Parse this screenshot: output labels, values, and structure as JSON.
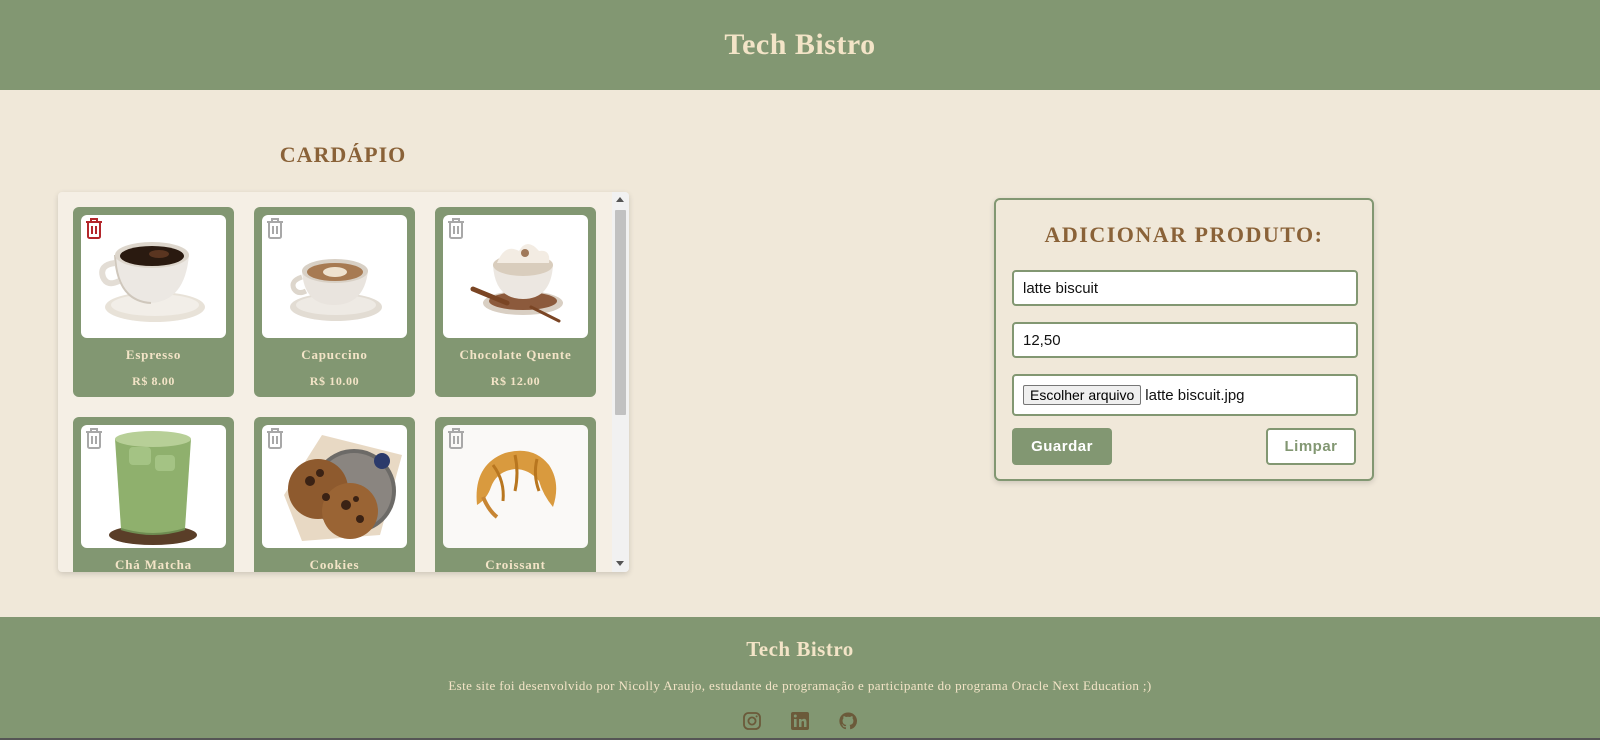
{
  "header": {
    "title": "Tech Bistro"
  },
  "menu": {
    "title": "CARDÁPIO",
    "items": [
      {
        "name": "Espresso",
        "price": "R$ 8.00",
        "image": "espresso-cup"
      },
      {
        "name": "Capuccino",
        "price": "R$ 10.00",
        "image": "cappuccino-cup"
      },
      {
        "name": "Chocolate Quente",
        "price": "R$ 12.00",
        "image": "hot-chocolate-cup"
      },
      {
        "name": "Chá Matcha",
        "price": "",
        "image": "matcha-glass"
      },
      {
        "name": "Cookies",
        "price": "",
        "image": "cookies-plate"
      },
      {
        "name": "Croissant",
        "price": "",
        "image": "croissant"
      }
    ],
    "trash_icon": "trash-icon",
    "trash_active_color": "#b3262b",
    "trash_color": "#a8a8a8"
  },
  "form": {
    "title": "ADICIONAR PRODUTO:",
    "name_value": "latte biscuit",
    "price_value": "12,50",
    "file_button": "Escolher arquivo",
    "file_name": "latte biscuit.jpg",
    "save_label": "Guardar",
    "clear_label": "Limpar"
  },
  "footer": {
    "title": "Tech Bistro",
    "text": "Este site foi desenvolvido por Nicolly Araujo, estudante de programação e participante do programa Oracle Next Education ;)",
    "socials": [
      "instagram-icon",
      "linkedin-icon",
      "github-icon"
    ]
  },
  "colors": {
    "primary": "#829772",
    "background": "#f0e8d9",
    "accent_text": "#8a6238",
    "header_text": "#f3e4c7"
  }
}
